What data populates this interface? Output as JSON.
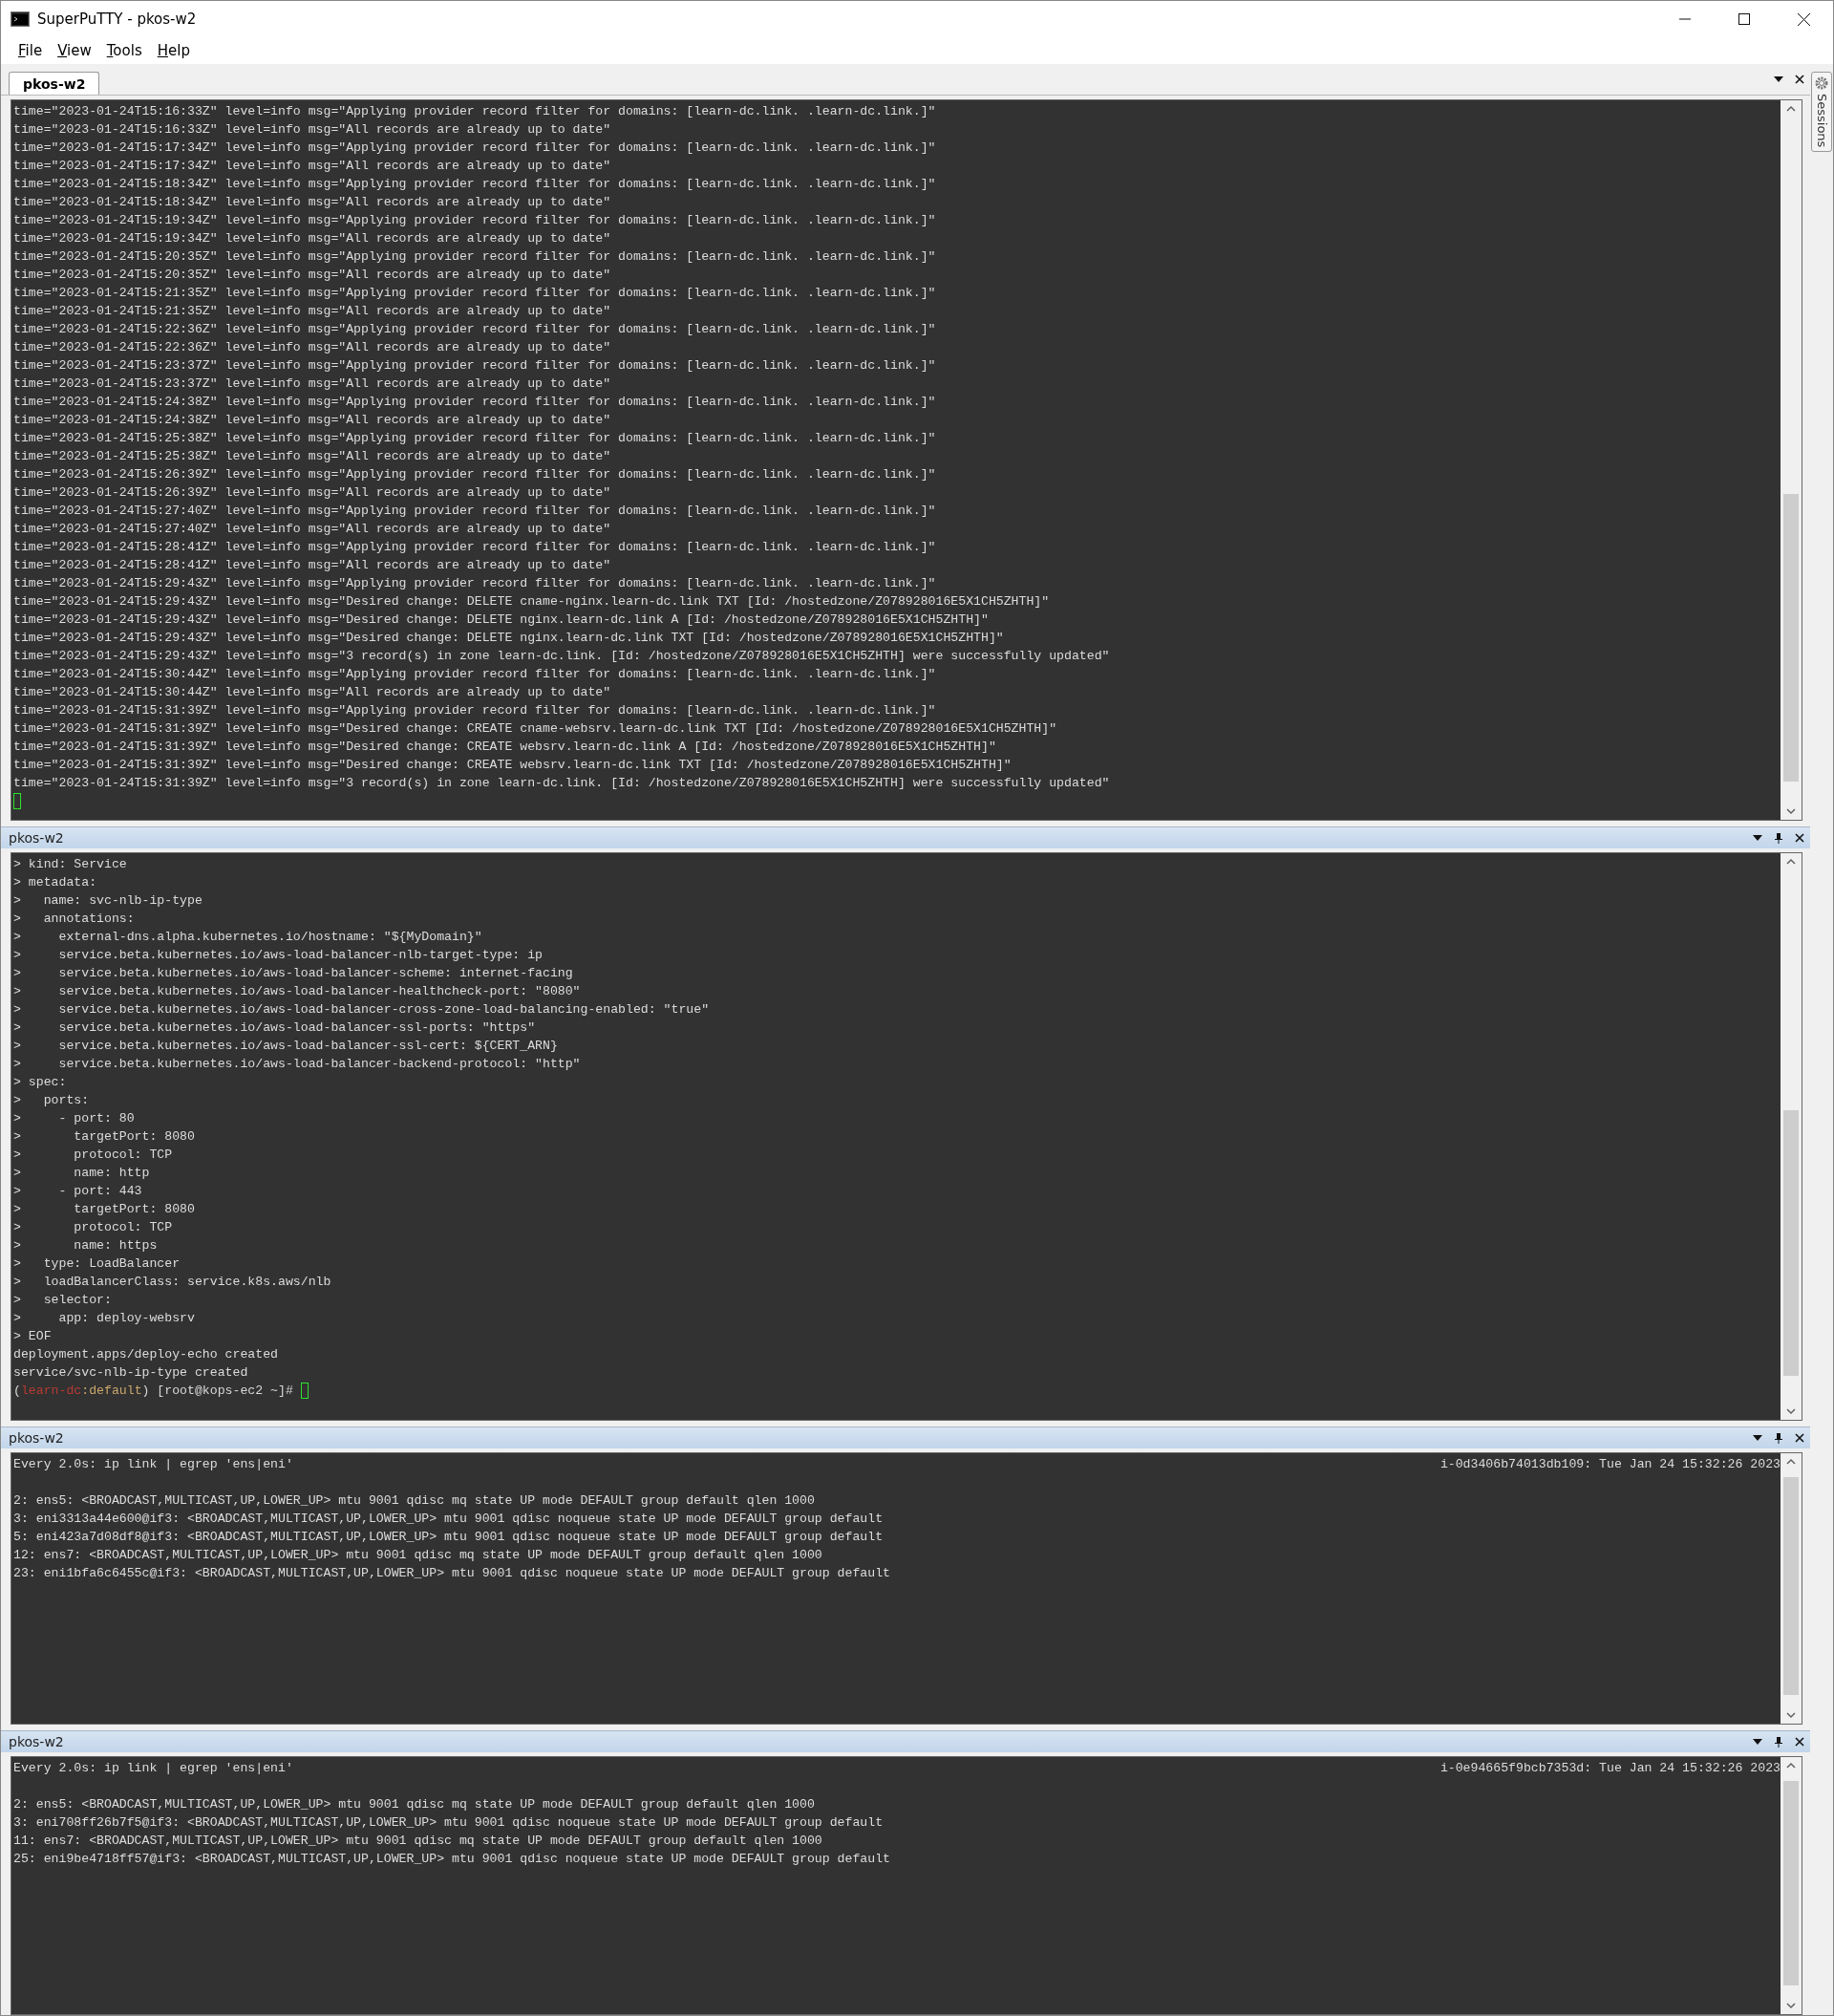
{
  "window": {
    "title": "SuperPuTTY - pkos-w2"
  },
  "menu": [
    "File",
    "View",
    "Tools",
    "Help"
  ],
  "tabs": [
    {
      "label": "pkos-w2",
      "selected": true
    }
  ],
  "sessions_tab": {
    "label": "Sessions"
  },
  "panels": [
    {
      "kind": "tabbed",
      "lines": [
        "time=\"2023-01-24T15:16:33Z\" level=info msg=\"Applying provider record filter for domains: [learn-dc.link. .learn-dc.link.]\"",
        "time=\"2023-01-24T15:16:33Z\" level=info msg=\"All records are already up to date\"",
        "time=\"2023-01-24T15:17:34Z\" level=info msg=\"Applying provider record filter for domains: [learn-dc.link. .learn-dc.link.]\"",
        "time=\"2023-01-24T15:17:34Z\" level=info msg=\"All records are already up to date\"",
        "time=\"2023-01-24T15:18:34Z\" level=info msg=\"Applying provider record filter for domains: [learn-dc.link. .learn-dc.link.]\"",
        "time=\"2023-01-24T15:18:34Z\" level=info msg=\"All records are already up to date\"",
        "time=\"2023-01-24T15:19:34Z\" level=info msg=\"Applying provider record filter for domains: [learn-dc.link. .learn-dc.link.]\"",
        "time=\"2023-01-24T15:19:34Z\" level=info msg=\"All records are already up to date\"",
        "time=\"2023-01-24T15:20:35Z\" level=info msg=\"Applying provider record filter for domains: [learn-dc.link. .learn-dc.link.]\"",
        "time=\"2023-01-24T15:20:35Z\" level=info msg=\"All records are already up to date\"",
        "time=\"2023-01-24T15:21:35Z\" level=info msg=\"Applying provider record filter for domains: [learn-dc.link. .learn-dc.link.]\"",
        "time=\"2023-01-24T15:21:35Z\" level=info msg=\"All records are already up to date\"",
        "time=\"2023-01-24T15:22:36Z\" level=info msg=\"Applying provider record filter for domains: [learn-dc.link. .learn-dc.link.]\"",
        "time=\"2023-01-24T15:22:36Z\" level=info msg=\"All records are already up to date\"",
        "time=\"2023-01-24T15:23:37Z\" level=info msg=\"Applying provider record filter for domains: [learn-dc.link. .learn-dc.link.]\"",
        "time=\"2023-01-24T15:23:37Z\" level=info msg=\"All records are already up to date\"",
        "time=\"2023-01-24T15:24:38Z\" level=info msg=\"Applying provider record filter for domains: [learn-dc.link. .learn-dc.link.]\"",
        "time=\"2023-01-24T15:24:38Z\" level=info msg=\"All records are already up to date\"",
        "time=\"2023-01-24T15:25:38Z\" level=info msg=\"Applying provider record filter for domains: [learn-dc.link. .learn-dc.link.]\"",
        "time=\"2023-01-24T15:25:38Z\" level=info msg=\"All records are already up to date\"",
        "time=\"2023-01-24T15:26:39Z\" level=info msg=\"Applying provider record filter for domains: [learn-dc.link. .learn-dc.link.]\"",
        "time=\"2023-01-24T15:26:39Z\" level=info msg=\"All records are already up to date\"",
        "time=\"2023-01-24T15:27:40Z\" level=info msg=\"Applying provider record filter for domains: [learn-dc.link. .learn-dc.link.]\"",
        "time=\"2023-01-24T15:27:40Z\" level=info msg=\"All records are already up to date\"",
        "time=\"2023-01-24T15:28:41Z\" level=info msg=\"Applying provider record filter for domains: [learn-dc.link. .learn-dc.link.]\"",
        "time=\"2023-01-24T15:28:41Z\" level=info msg=\"All records are already up to date\"",
        "time=\"2023-01-24T15:29:43Z\" level=info msg=\"Applying provider record filter for domains: [learn-dc.link. .learn-dc.link.]\"",
        "time=\"2023-01-24T15:29:43Z\" level=info msg=\"Desired change: DELETE cname-nginx.learn-dc.link TXT [Id: /hostedzone/Z078928016E5X1CH5ZHTH]\"",
        "time=\"2023-01-24T15:29:43Z\" level=info msg=\"Desired change: DELETE nginx.learn-dc.link A [Id: /hostedzone/Z078928016E5X1CH5ZHTH]\"",
        "time=\"2023-01-24T15:29:43Z\" level=info msg=\"Desired change: DELETE nginx.learn-dc.link TXT [Id: /hostedzone/Z078928016E5X1CH5ZHTH]\"",
        "time=\"2023-01-24T15:29:43Z\" level=info msg=\"3 record(s) in zone learn-dc.link. [Id: /hostedzone/Z078928016E5X1CH5ZHTH] were successfully updated\"",
        "time=\"2023-01-24T15:30:44Z\" level=info msg=\"Applying provider record filter for domains: [learn-dc.link. .learn-dc.link.]\"",
        "time=\"2023-01-24T15:30:44Z\" level=info msg=\"All records are already up to date\"",
        "time=\"2023-01-24T15:31:39Z\" level=info msg=\"Applying provider record filter for domains: [learn-dc.link. .learn-dc.link.]\"",
        "time=\"2023-01-24T15:31:39Z\" level=info msg=\"Desired change: CREATE cname-websrv.learn-dc.link TXT [Id: /hostedzone/Z078928016E5X1CH5ZHTH]\"",
        "time=\"2023-01-24T15:31:39Z\" level=info msg=\"Desired change: CREATE websrv.learn-dc.link A [Id: /hostedzone/Z078928016E5X1CH5ZHTH]\"",
        "time=\"2023-01-24T15:31:39Z\" level=info msg=\"Desired change: CREATE websrv.learn-dc.link TXT [Id: /hostedzone/Z078928016E5X1CH5ZHTH]\"",
        "time=\"2023-01-24T15:31:39Z\" level=info msg=\"3 record(s) in zone learn-dc.link. [Id: /hostedzone/Z078928016E5X1CH5ZHTH] were successfully updated\""
      ]
    },
    {
      "kind": "docked",
      "title": "pkos-w2",
      "lines": [
        "> kind: Service",
        "> metadata:",
        ">   name: svc-nlb-ip-type",
        ">   annotations:",
        ">     external-dns.alpha.kubernetes.io/hostname: \"${MyDomain}\"",
        ">     service.beta.kubernetes.io/aws-load-balancer-nlb-target-type: ip",
        ">     service.beta.kubernetes.io/aws-load-balancer-scheme: internet-facing",
        ">     service.beta.kubernetes.io/aws-load-balancer-healthcheck-port: \"8080\"",
        ">     service.beta.kubernetes.io/aws-load-balancer-cross-zone-load-balancing-enabled: \"true\"",
        ">     service.beta.kubernetes.io/aws-load-balancer-ssl-ports: \"https\"",
        ">     service.beta.kubernetes.io/aws-load-balancer-ssl-cert: ${CERT_ARN}",
        ">     service.beta.kubernetes.io/aws-load-balancer-backend-protocol: \"http\"",
        "> spec:",
        ">   ports:",
        ">     - port: 80",
        ">       targetPort: 8080",
        ">       protocol: TCP",
        ">       name: http",
        ">     - port: 443",
        ">       targetPort: 8080",
        ">       protocol: TCP",
        ">       name: https",
        ">   type: LoadBalancer",
        ">   loadBalancerClass: service.k8s.aws/nlb",
        ">   selector:",
        ">     app: deploy-websrv",
        "> EOF",
        "deployment.apps/deploy-echo created",
        "service/svc-nlb-ip-type created"
      ],
      "prompt": [
        {
          "text": "(",
          "kind": "plain"
        },
        {
          "text": "learn-dc",
          "kind": "cluster"
        },
        {
          "text": ":default",
          "kind": "namespace"
        },
        {
          "text": ") [root@kops-ec2 ~]#",
          "kind": "plain"
        }
      ]
    },
    {
      "kind": "docked",
      "title": "pkos-w2",
      "header": {
        "command": "Every 2.0s: ip link | egrep 'ens|eni'",
        "status": "i-0d3406b74013db109: Tue Jan 24 15:32:26 2023"
      },
      "lines": [
        "2: ens5: <BROADCAST,MULTICAST,UP,LOWER_UP> mtu 9001 qdisc mq state UP mode DEFAULT group default qlen 1000",
        "3: eni3313a44e600@if3: <BROADCAST,MULTICAST,UP,LOWER_UP> mtu 9001 qdisc noqueue state UP mode DEFAULT group default",
        "5: eni423a7d08df8@if3: <BROADCAST,MULTICAST,UP,LOWER_UP> mtu 9001 qdisc noqueue state UP mode DEFAULT group default",
        "12: ens7: <BROADCAST,MULTICAST,UP,LOWER_UP> mtu 9001 qdisc mq state UP mode DEFAULT group default qlen 1000",
        "23: eni1bfa6c6455c@if3: <BROADCAST,MULTICAST,UP,LOWER_UP> mtu 9001 qdisc noqueue state UP mode DEFAULT group default"
      ]
    },
    {
      "kind": "docked",
      "title": "pkos-w2",
      "header": {
        "command": "Every 2.0s: ip link | egrep 'ens|eni'",
        "status": "i-0e94665f9bcb7353d: Tue Jan 24 15:32:26 2023"
      },
      "lines": [
        "2: ens5: <BROADCAST,MULTICAST,UP,LOWER_UP> mtu 9001 qdisc mq state UP mode DEFAULT group default qlen 1000",
        "3: eni708ff26b7f5@if3: <BROADCAST,MULTICAST,UP,LOWER_UP> mtu 9001 qdisc noqueue state UP mode DEFAULT group default",
        "11: ens7: <BROADCAST,MULTICAST,UP,LOWER_UP> mtu 9001 qdisc mq state UP mode DEFAULT group default qlen 1000",
        "25: eni9be4718ff57@if3: <BROADCAST,MULTICAST,UP,LOWER_UP> mtu 9001 qdisc noqueue state UP mode DEFAULT group default"
      ]
    }
  ]
}
